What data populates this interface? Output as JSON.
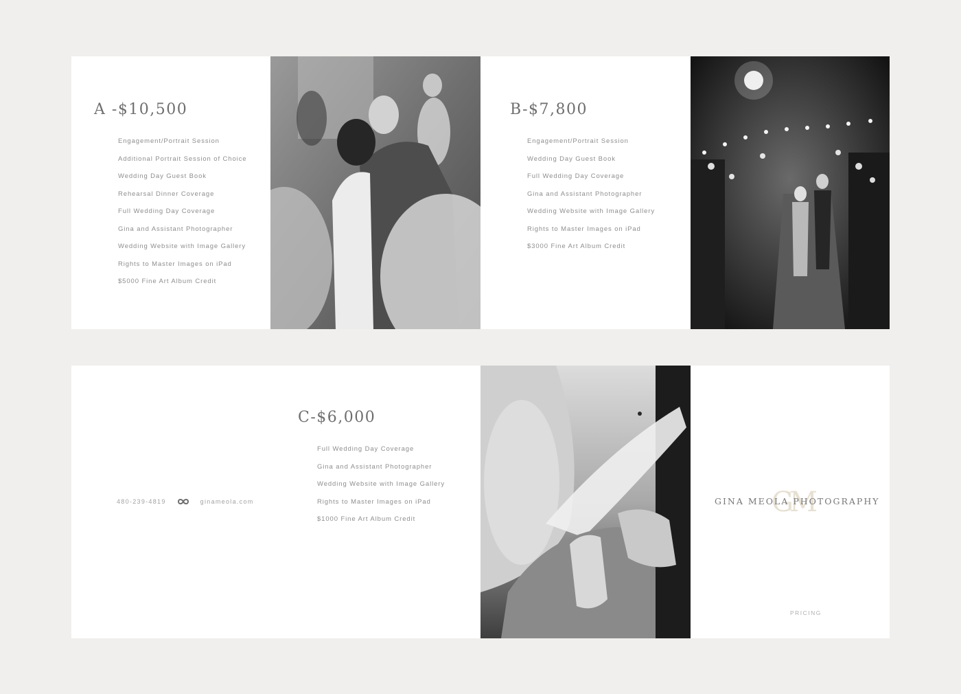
{
  "package_a": {
    "price": "A -$10,500",
    "items": [
      "Engagement/Portrait Session",
      "Additional Portrait Session of Choice",
      "Wedding Day Guest Book",
      "Rehearsal Dinner Coverage",
      "Full Wedding Day Coverage",
      "Gina and Assistant Photographer",
      "Wedding Website with Image Gallery",
      "Rights to Master Images on iPad",
      "$5000 Fine Art Album Credit"
    ]
  },
  "package_b": {
    "price": "B-$7,800",
    "items": [
      "Engagement/Portrait Session",
      "Wedding Day Guest Book",
      "Full Wedding Day Coverage",
      "Gina and Assistant Photographer",
      "Wedding Website with Image Gallery",
      "Rights to Master Images on iPad",
      "$3000 Fine Art Album Credit"
    ]
  },
  "package_c": {
    "price": "C-$6,000",
    "items": [
      "Full Wedding Day Coverage",
      "Gina and Assistant Photographer",
      "Wedding Website with Image Gallery",
      "Rights to Master Images on iPad",
      "$1000 Fine Art Album Credit"
    ]
  },
  "contact": {
    "phone": "480-239-4819",
    "website": "ginameola.com"
  },
  "brand": {
    "monogram": "GM",
    "name": "GINA MEOLA PHOTOGRAPHY",
    "section_label": "PRICING"
  },
  "icons": {
    "contact_mark": "infinity-loop-icon"
  },
  "colors": {
    "page_background": "#f0efed",
    "panel_background": "#ffffff",
    "heading_text": "#6e6e6e",
    "body_text": "#8e8e8e",
    "monogram_tint": "#e7e0d2"
  }
}
